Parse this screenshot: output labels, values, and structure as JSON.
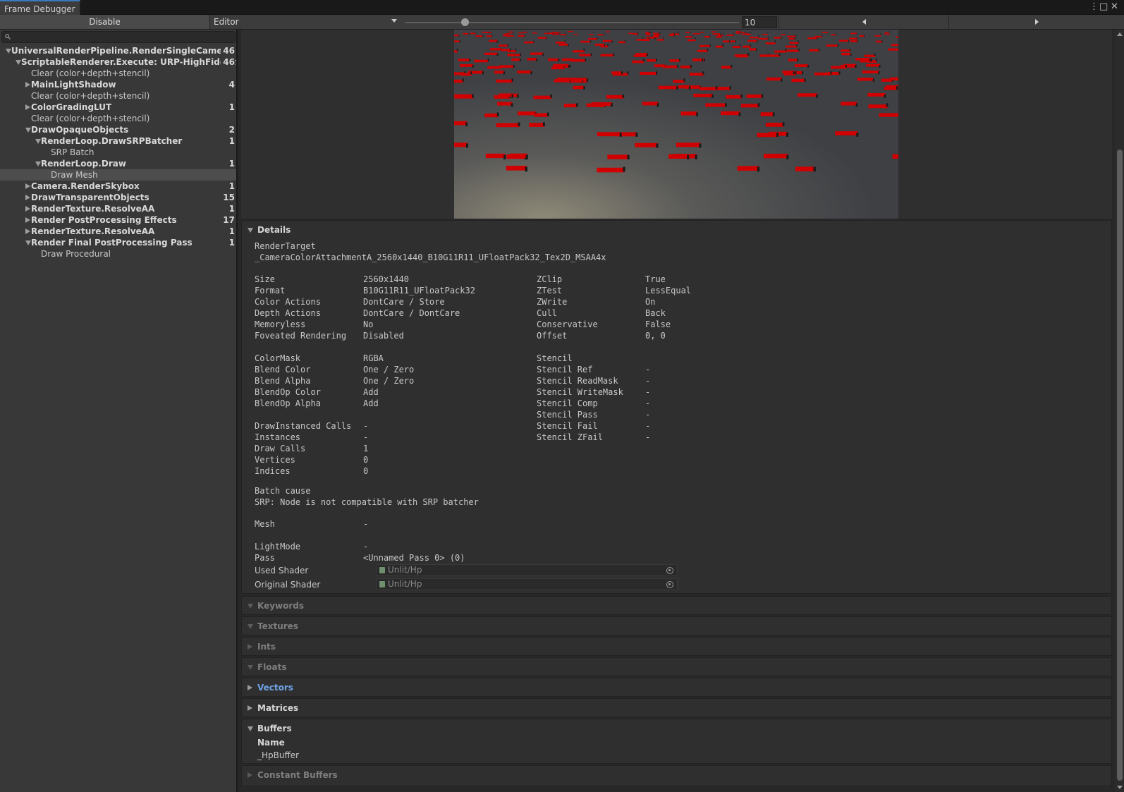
{
  "window": {
    "tab_title": "Frame Debugger",
    "menu_icon": "kebab-menu-icon",
    "maximize_icon": "maximize-icon",
    "close_icon": "close-icon"
  },
  "toolbar": {
    "disable_label": "Disable",
    "target_label": "Editor",
    "frame_value": "10",
    "frame_fraction": 0.18
  },
  "search": {
    "placeholder": ""
  },
  "tree": [
    {
      "label": "UniversalRenderPipeline.RenderSingleCameraInter",
      "count": "46",
      "depth": 0,
      "fold": "open",
      "bold": true
    },
    {
      "label": "ScriptableRenderer.Execute: URP-HighFidelity-R",
      "count": "46",
      "depth": 1,
      "fold": "open",
      "bold": true
    },
    {
      "label": "Clear (color+depth+stencil)",
      "count": "",
      "depth": 2,
      "fold": "none",
      "bold": false
    },
    {
      "label": "MainLightShadow",
      "count": "4",
      "depth": 2,
      "fold": "closed",
      "bold": true
    },
    {
      "label": "Clear (color+depth+stencil)",
      "count": "",
      "depth": 2,
      "fold": "none",
      "bold": false
    },
    {
      "label": "ColorGradingLUT",
      "count": "1",
      "depth": 2,
      "fold": "closed",
      "bold": true
    },
    {
      "label": "Clear (color+depth+stencil)",
      "count": "",
      "depth": 2,
      "fold": "none",
      "bold": false
    },
    {
      "label": "DrawOpaqueObjects",
      "count": "2",
      "depth": 2,
      "fold": "open",
      "bold": true
    },
    {
      "label": "RenderLoop.DrawSRPBatcher",
      "count": "1",
      "depth": 3,
      "fold": "open",
      "bold": true
    },
    {
      "label": "SRP Batch",
      "count": "",
      "depth": 4,
      "fold": "none",
      "bold": false
    },
    {
      "label": "RenderLoop.Draw",
      "count": "1",
      "depth": 3,
      "fold": "open",
      "bold": true
    },
    {
      "label": "Draw Mesh",
      "count": "",
      "depth": 4,
      "fold": "none",
      "bold": false,
      "selected": true
    },
    {
      "label": "Camera.RenderSkybox",
      "count": "1",
      "depth": 2,
      "fold": "closed",
      "bold": true
    },
    {
      "label": "DrawTransparentObjects",
      "count": "15",
      "depth": 2,
      "fold": "closed",
      "bold": true
    },
    {
      "label": "RenderTexture.ResolveAA",
      "count": "1",
      "depth": 2,
      "fold": "closed",
      "bold": true
    },
    {
      "label": "Render PostProcessing Effects",
      "count": "17",
      "depth": 2,
      "fold": "closed",
      "bold": true
    },
    {
      "label": "RenderTexture.ResolveAA",
      "count": "1",
      "depth": 2,
      "fold": "closed",
      "bold": true
    },
    {
      "label": "Render Final PostProcessing Pass",
      "count": "1",
      "depth": 2,
      "fold": "open",
      "bold": true
    },
    {
      "label": "Draw Procedural",
      "count": "",
      "depth": 3,
      "fold": "none",
      "bold": false
    }
  ],
  "details": {
    "title": "Details",
    "render_target_label": "RenderTarget",
    "render_target_value": "_CameraColorAttachmentA_2560x1440_B10G11R11_UFloatPack32_Tex2D_MSAA4x",
    "left_rows": [
      {
        "k": "Size",
        "v": "2560x1440",
        "row": 0
      },
      {
        "k": "Format",
        "v": "B10G11R11_UFloatPack32",
        "row": 1
      },
      {
        "k": "Color Actions",
        "v": "DontCare / Store",
        "row": 2
      },
      {
        "k": "Depth Actions",
        "v": "DontCare / DontCare",
        "row": 3
      },
      {
        "k": "Memoryless",
        "v": "No",
        "row": 4
      },
      {
        "k": "Foveated Rendering",
        "v": "Disabled",
        "row": 5
      },
      {
        "k": "ColorMask",
        "v": "RGBA",
        "row": 7
      },
      {
        "k": "Blend Color",
        "v": "One / Zero",
        "row": 8
      },
      {
        "k": "Blend Alpha",
        "v": "One / Zero",
        "row": 9
      },
      {
        "k": "BlendOp Color",
        "v": "Add",
        "row": 10
      },
      {
        "k": "BlendOp Alpha",
        "v": "Add",
        "row": 11
      },
      {
        "k": "DrawInstanced Calls",
        "v": "-",
        "row": 13
      },
      {
        "k": "Instances",
        "v": "-",
        "row": 14
      },
      {
        "k": "Draw Calls",
        "v": "1",
        "row": 15
      },
      {
        "k": "Vertices",
        "v": "0",
        "row": 16
      },
      {
        "k": "Indices",
        "v": "0",
        "row": 17
      }
    ],
    "right_rows": [
      {
        "k": "ZClip",
        "v": "True",
        "row": 0
      },
      {
        "k": "ZTest",
        "v": "LessEqual",
        "row": 1
      },
      {
        "k": "ZWrite",
        "v": "On",
        "row": 2
      },
      {
        "k": "Cull",
        "v": "Back",
        "row": 3
      },
      {
        "k": "Conservative",
        "v": "False",
        "row": 4
      },
      {
        "k": "Offset",
        "v": "0, 0",
        "row": 5
      },
      {
        "k": "Stencil",
        "v": "",
        "row": 7
      },
      {
        "k": "Stencil Ref",
        "v": "-",
        "row": 8
      },
      {
        "k": "Stencil ReadMask",
        "v": "-",
        "row": 9
      },
      {
        "k": "Stencil WriteMask",
        "v": "-",
        "row": 10
      },
      {
        "k": "Stencil Comp",
        "v": "-",
        "row": 11
      },
      {
        "k": "Stencil Pass",
        "v": "-",
        "row": 12
      },
      {
        "k": "Stencil Fail",
        "v": "-",
        "row": 13
      },
      {
        "k": "Stencil ZFail",
        "v": "-",
        "row": 14
      }
    ],
    "batch_cause_label": "Batch cause",
    "batch_cause_value": "SRP: Node is not compatible with SRP batcher",
    "mesh_label": "Mesh",
    "mesh_value": "-",
    "lightmode_label": "LightMode",
    "lightmode_value": "-",
    "pass_label": "Pass",
    "pass_value": "<Unnamed Pass 0> (0)",
    "used_shader_label": "Used Shader",
    "used_shader_value": "Unlit/Hp",
    "original_shader_label": "Original Shader",
    "original_shader_value": "Unlit/Hp"
  },
  "sections": {
    "keywords": "Keywords",
    "textures": "Textures",
    "ints": "Ints",
    "floats": "Floats",
    "vectors": "Vectors",
    "matrices": "Matrices",
    "buffers": "Buffers",
    "buffers_header": "Name",
    "buffers_item": "_HpBuffer",
    "constant_buffers": "Constant Buffers"
  },
  "colors": {
    "accent_blue": "#6fa3e6",
    "selection": "#4d4d4d",
    "preview_red": "#d10000"
  }
}
